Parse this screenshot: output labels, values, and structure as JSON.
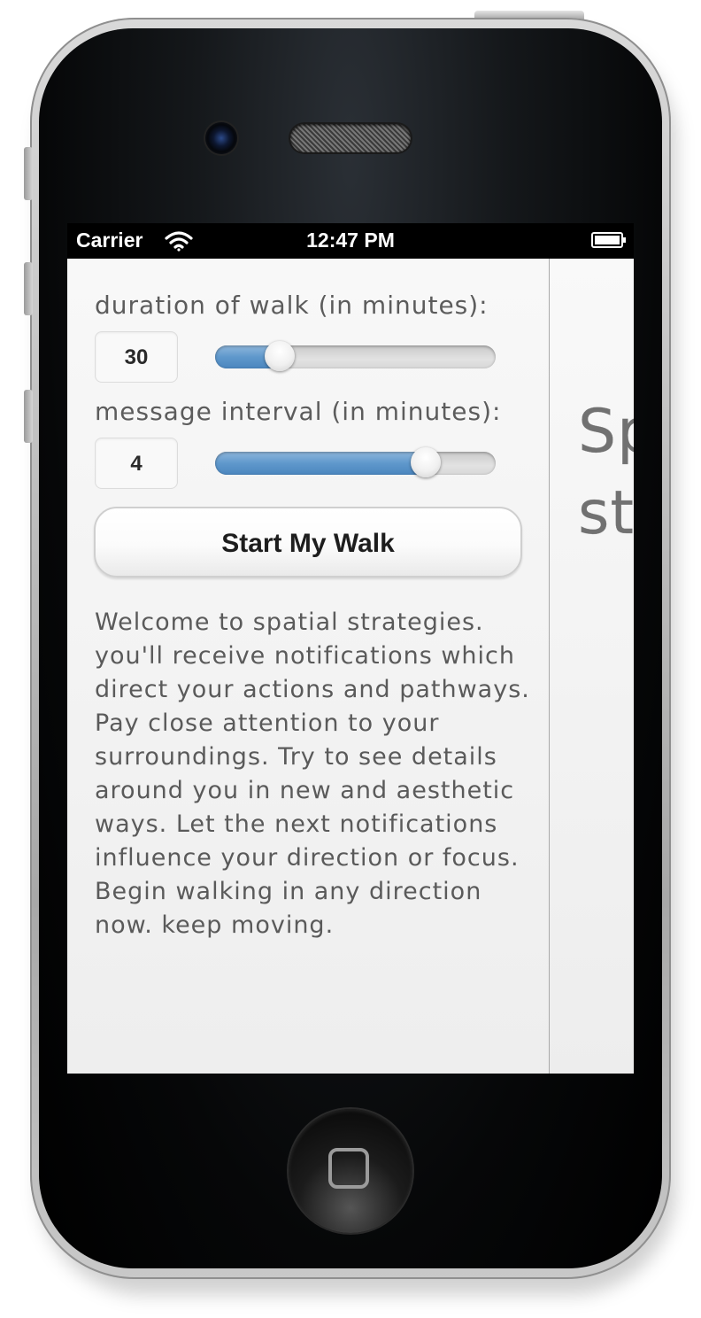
{
  "status_bar": {
    "carrier": "Carrier",
    "time": "12:47 PM",
    "wifi_icon": "wifi-icon",
    "battery_icon": "battery-icon"
  },
  "form": {
    "duration_label": "duration of walk (in minutes):",
    "duration_value": "30",
    "duration_slider_fraction": 0.23,
    "interval_label": "message interval (in minutes):",
    "interval_value": "4",
    "interval_slider_fraction": 0.75,
    "start_button_label": "Start My Walk"
  },
  "welcome_text": "Welcome to spatial strategies. you'll receive notifications which direct your actions and pathways. Pay close attention to your surroundings. Try to see details around you in new and aesthetic ways. Let the next notifications influence your direction or focus. Begin walking in any direction now. keep moving.",
  "right_panel": {
    "title_line_1": "Sp",
    "title_line_2": "st"
  },
  "colors": {
    "slider_fill": "#5f98cc",
    "panel_background": "#f2f2f2",
    "text": "#5a5a5a"
  },
  "hardware": {
    "home_button_icon": "home-square-icon"
  }
}
